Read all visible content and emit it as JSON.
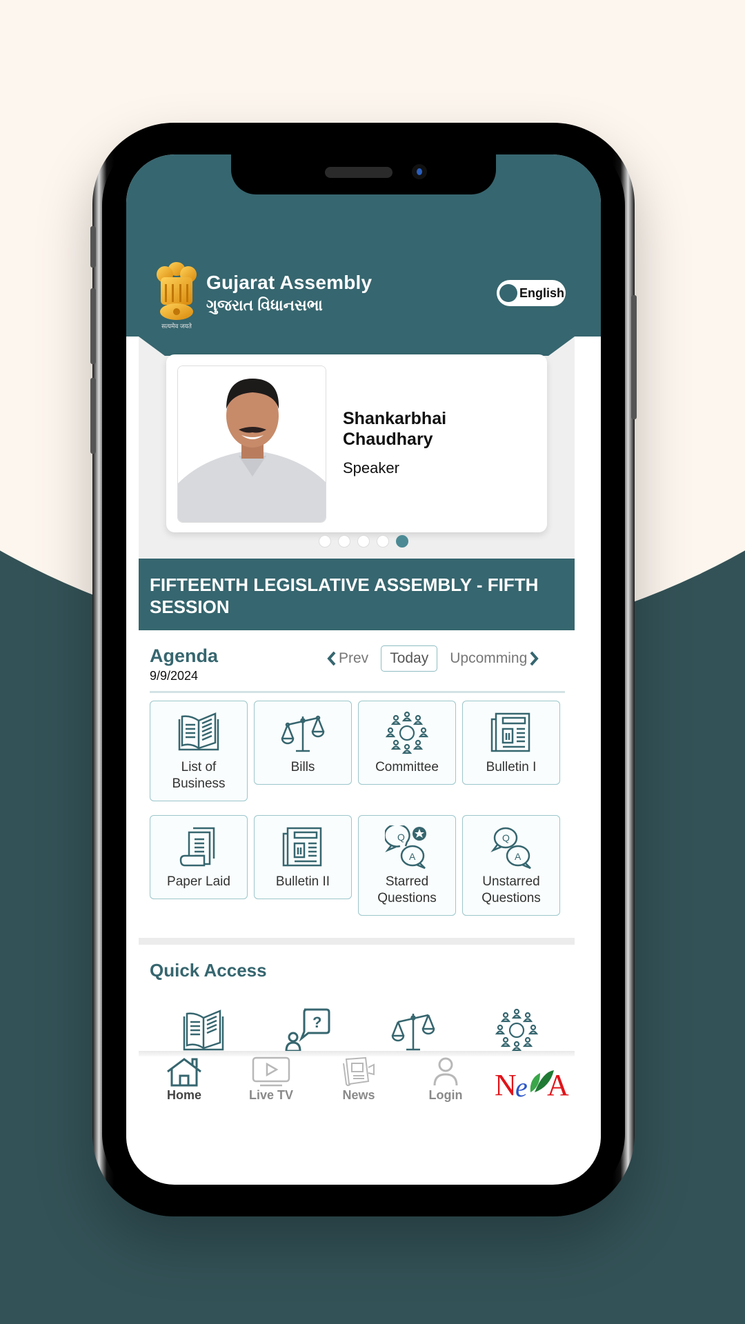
{
  "app": {
    "title": "Gujarat Assembly",
    "subtitle": "ગુજરાત વિધાનસભા",
    "emblem_motto": "सत्यमेव जयते",
    "language_toggle": "English"
  },
  "carousel": {
    "name_line1": "Shankarbhai",
    "name_line2": "Chaudhary",
    "role": "Speaker",
    "slide_count": 5,
    "active_slide": 5
  },
  "session": {
    "title": "FIFTEENTH LEGISLATIVE ASSEMBLY - FIFTH SESSION"
  },
  "agenda": {
    "title": "Agenda",
    "date": "9/9/2024",
    "prev_label": "Prev",
    "today_label": "Today",
    "upcoming_label": "Upcomming",
    "tiles": [
      {
        "label_line1": "List of",
        "label_line2": "Business",
        "icon": "open-book-icon"
      },
      {
        "label_line1": "Bills",
        "label_line2": "",
        "icon": "scales-icon"
      },
      {
        "label_line1": "Committee",
        "label_line2": "",
        "icon": "committee-icon"
      },
      {
        "label_line1": "Bulletin I",
        "label_line2": "",
        "icon": "newspaper-icon"
      },
      {
        "label_line1": "Paper Laid",
        "label_line2": "",
        "icon": "documents-icon"
      },
      {
        "label_line1": "Bulletin II",
        "label_line2": "",
        "icon": "newspaper-icon"
      },
      {
        "label_line1": "Starred",
        "label_line2": "Questions",
        "icon": "starred-qa-icon"
      },
      {
        "label_line1": "Unstarred",
        "label_line2": "Questions",
        "icon": "qa-icon"
      }
    ]
  },
  "quick_access": {
    "title": "Quick Access",
    "items": [
      "open-book-icon",
      "question-person-icon",
      "scales-icon",
      "committee-icon"
    ]
  },
  "bottom_nav": {
    "items": [
      {
        "label": "Home",
        "icon": "home-icon",
        "active": true
      },
      {
        "label": "Live TV",
        "icon": "tv-play-icon",
        "active": false
      },
      {
        "label": "News",
        "icon": "news-icon",
        "active": false
      },
      {
        "label": "Login",
        "icon": "user-icon",
        "active": false
      }
    ],
    "brand_logo": "NeVA"
  },
  "colors": {
    "primary": "#36666f",
    "accent": "#4b8a94",
    "tile_border": "#9cc6cb",
    "background_light": "#fdf6ee",
    "background_dark": "#335257"
  }
}
